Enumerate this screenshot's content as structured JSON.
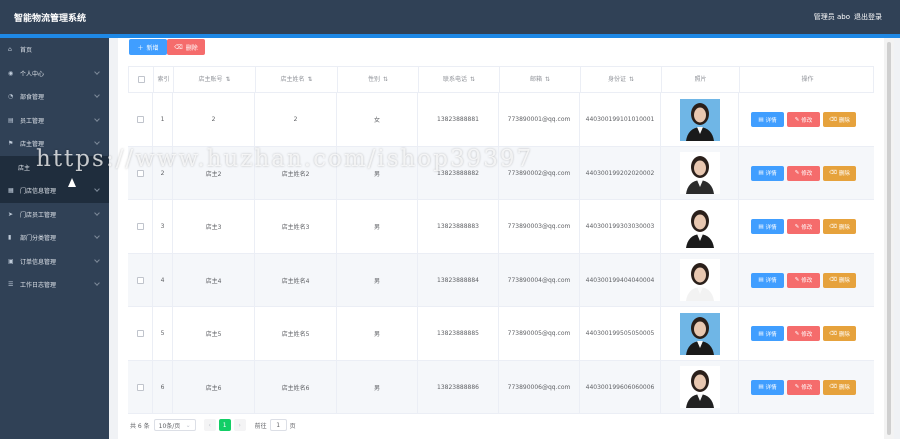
{
  "app": {
    "title": "智能物流管理系统",
    "user": "管理员 abo",
    "logout": "退出登录"
  },
  "sidebar": {
    "items": [
      {
        "label": "首页",
        "icon": "home-icon",
        "glyph": "⌂",
        "chevron": false
      },
      {
        "label": "个人中心",
        "icon": "person-icon",
        "glyph": "◉",
        "chevron": true
      },
      {
        "label": "部食管理",
        "icon": "clock-icon",
        "glyph": "◔",
        "chevron": true
      },
      {
        "label": "员工管理",
        "icon": "doc-icon",
        "glyph": "▤",
        "chevron": true
      },
      {
        "label": "店主管理",
        "icon": "flag-icon",
        "glyph": "⚑",
        "chevron": true
      },
      {
        "label": "店主",
        "icon": "",
        "glyph": "",
        "chevron": false,
        "sub": true
      },
      {
        "label": "门店信息管理",
        "icon": "grid-icon",
        "glyph": "▦",
        "chevron": true
      },
      {
        "label": "门店员工管理",
        "icon": "send-icon",
        "glyph": "➤",
        "chevron": true
      },
      {
        "label": "部门分类管理",
        "icon": "chart-icon",
        "glyph": "▮",
        "chevron": true
      },
      {
        "label": "订单信息管理",
        "icon": "bag-icon",
        "glyph": "▣",
        "chevron": true
      },
      {
        "label": "工作日志管理",
        "icon": "list-icon",
        "glyph": "☰",
        "chevron": true
      }
    ]
  },
  "toolbar": {
    "add_label": "新增",
    "delete_label": "删除"
  },
  "table": {
    "headers": [
      "索引",
      "店主账号",
      "店主姓名",
      "性别",
      "联系电话",
      "邮箱",
      "身份证",
      "照片",
      "操作"
    ],
    "sort_glyph": "⇅",
    "rows": [
      {
        "index": "1",
        "account": "2",
        "name": "2",
        "gender": "女",
        "phone": "13823888881",
        "email": "773890001@qq.com",
        "idcard": "440300199101010001"
      },
      {
        "index": "2",
        "account": "店主2",
        "name": "店主姓名2",
        "gender": "男",
        "phone": "13823888882",
        "email": "773890002@qq.com",
        "idcard": "440300199202020002"
      },
      {
        "index": "3",
        "account": "店主3",
        "name": "店主姓名3",
        "gender": "男",
        "phone": "13823888883",
        "email": "773890003@qq.com",
        "idcard": "440300199303030003"
      },
      {
        "index": "4",
        "account": "店主4",
        "name": "店主姓名4",
        "gender": "男",
        "phone": "13823888884",
        "email": "773890004@qq.com",
        "idcard": "440300199404040004"
      },
      {
        "index": "5",
        "account": "店主5",
        "name": "店主姓名5",
        "gender": "男",
        "phone": "13823888885",
        "email": "773890005@qq.com",
        "idcard": "440300199505050005"
      },
      {
        "index": "6",
        "account": "店主6",
        "name": "店主姓名6",
        "gender": "男",
        "phone": "13823888886",
        "email": "773890006@qq.com",
        "idcard": "440300199606060006"
      }
    ],
    "actions": {
      "detail": "详情",
      "edit": "修改",
      "remove": "删除"
    }
  },
  "pagination": {
    "total": "共 6 条",
    "page_size": "10条/页",
    "current": "1",
    "goto_label": "前往",
    "goto_value": "1",
    "page_suffix": "页"
  },
  "watermark": "https://www.huzhan.com/ishop39397",
  "colors": {
    "topbar": "#304156",
    "primary": "#409eff",
    "danger": "#f56c6c",
    "warning": "#e6a23c",
    "pager_active": "#13ce66"
  }
}
